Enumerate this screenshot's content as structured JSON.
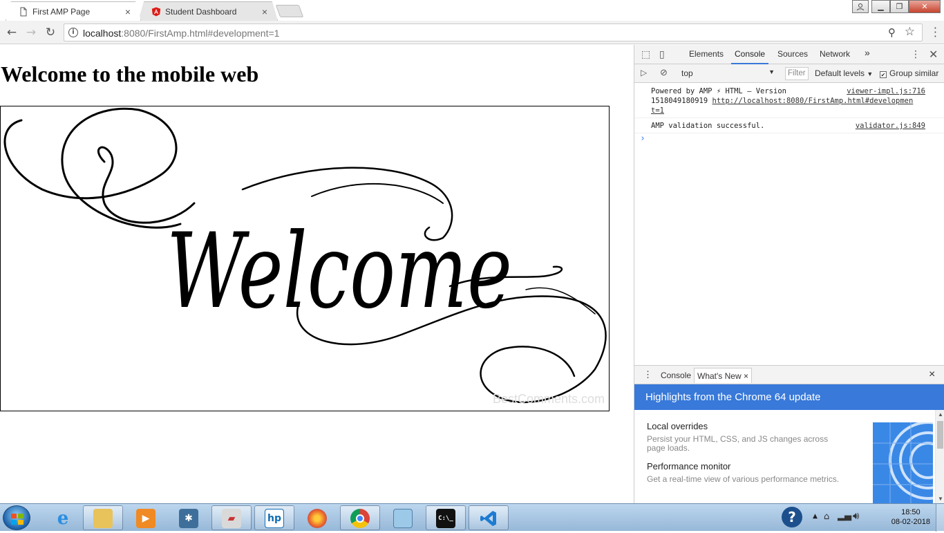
{
  "tabs": [
    {
      "label": "First AMP Page",
      "close": "×"
    },
    {
      "label": "Student Dashboard",
      "close": "×"
    }
  ],
  "address": {
    "host": "localhost",
    "rest": ":8080/FirstAmp.html#development=1",
    "info_glyph": "i"
  },
  "page": {
    "heading": "Welcome to the mobile web",
    "image_text": "Welcome",
    "watermark": "BestComments.com"
  },
  "devtools": {
    "tabs": [
      "Elements",
      "Console",
      "Sources",
      "Network"
    ],
    "more": "»",
    "context": "top",
    "filter_placeholder": "Filter",
    "levels": "Default levels",
    "group_similar": "Group similar",
    "messages": [
      {
        "text_line1": "Powered by AMP ⚡ HTML – Version",
        "text_line2": "1518049180919",
        "link": "http://localhost:8080/FirstAmp.html#developmen",
        "link_tail": "t=1",
        "source": "viewer-impl.js:716"
      },
      {
        "text_line1": "AMP validation successful.",
        "source": "validator.js:849"
      }
    ],
    "prompt": "›"
  },
  "drawer": {
    "tabs": [
      "Console",
      "What's New"
    ],
    "close": "×",
    "banner": "Highlights from the Chrome 64 update",
    "items": [
      {
        "title": "Local overrides",
        "desc": "Persist your HTML, CSS, and JS changes across page loads."
      },
      {
        "title": "Performance monitor",
        "desc": "Get a real-time view of various performance metrics."
      }
    ]
  },
  "taskbar": {
    "clock_time": "18:50",
    "clock_date": "08-02-2018",
    "items": [
      "explorer",
      "file-manager",
      "media-player",
      "photo-viewer",
      "image-tool",
      "hp-tool",
      "firefox",
      "chrome",
      "notepad",
      "cmd",
      "visual-studio-code"
    ]
  },
  "colors": {
    "accent": "#3879d9",
    "tab_active_underline": "#3879d9",
    "taskbar": "#a9c7e4"
  }
}
